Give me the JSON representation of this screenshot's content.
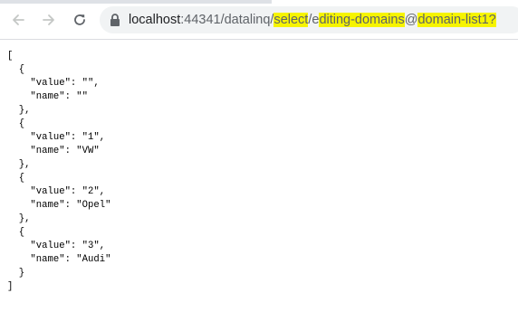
{
  "browser": {
    "url_host": "localhost",
    "url_port": ":44341",
    "url_seg1": "/datalinq/",
    "url_seg2": "select",
    "url_seg3": "/e",
    "url_seg4": "diting-domains",
    "url_seg5": "@",
    "url_seg6": "domain-list1?",
    "icons": {
      "back": "back-arrow-icon",
      "forward": "forward-arrow-icon",
      "reload": "reload-icon",
      "lock": "lock-icon"
    },
    "colors": {
      "highlight": "#f6f400"
    }
  },
  "json_text": "[\n  {\n    \"value\": \"\",\n    \"name\": \"\"\n  },\n  {\n    \"value\": \"1\",\n    \"name\": \"VW\"\n  },\n  {\n    \"value\": \"2\",\n    \"name\": \"Opel\"\n  },\n  {\n    \"value\": \"3\",\n    \"name\": \"Audi\"\n  }\n]"
}
